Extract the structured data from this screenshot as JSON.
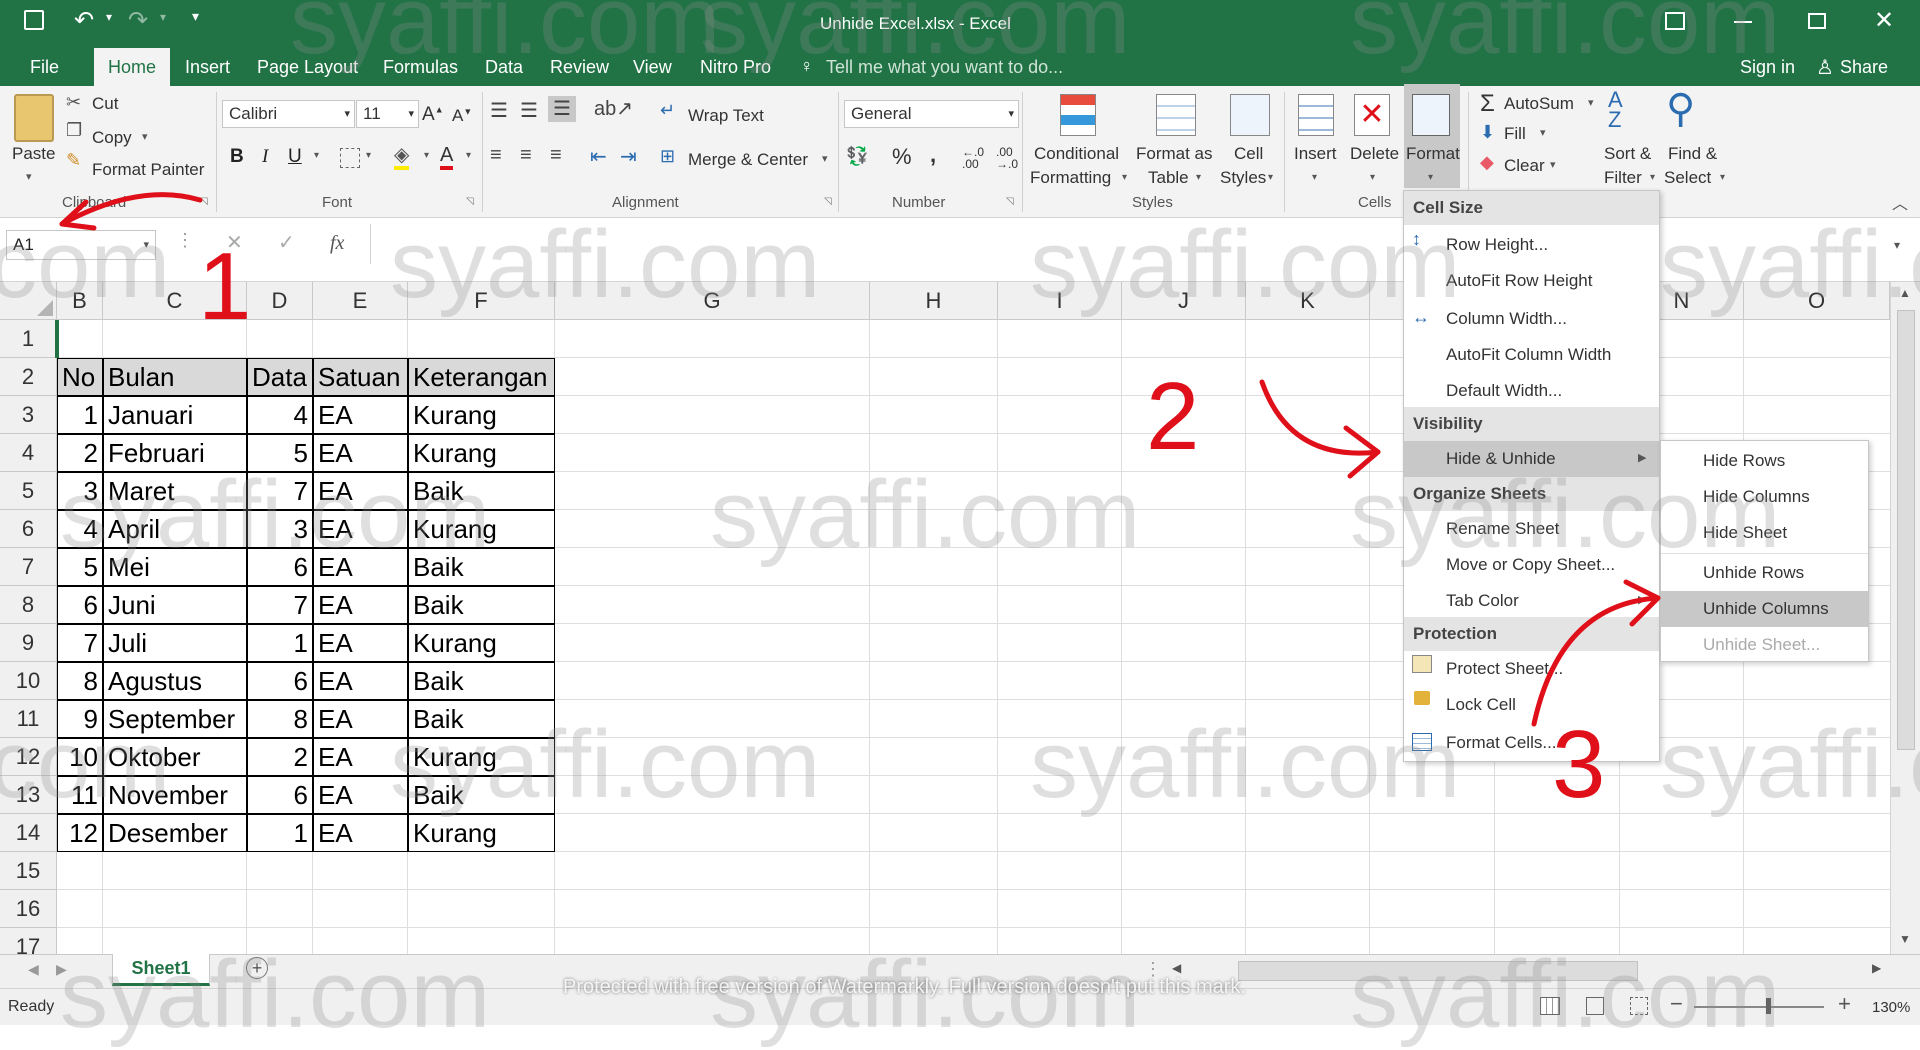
{
  "titlebar": {
    "title": "Unhide Excel.xlsx - Excel"
  },
  "tabs": {
    "file": "File",
    "home": "Home",
    "insert": "Insert",
    "page_layout": "Page Layout",
    "formulas": "Formulas",
    "data": "Data",
    "review": "Review",
    "view": "View",
    "nitro": "Nitro Pro",
    "tell_me": "Tell me what you want to do...",
    "sign_in": "Sign in",
    "share": "Share"
  },
  "ribbon": {
    "clipboard": {
      "paste": "Paste",
      "cut": "Cut",
      "copy": "Copy",
      "format_painter": "Format Painter",
      "label": "Clipboard"
    },
    "font": {
      "name": "Calibri",
      "size": "11",
      "label": "Font"
    },
    "alignment": {
      "wrap": "Wrap Text",
      "merge": "Merge & Center",
      "label": "Alignment"
    },
    "number": {
      "format": "General",
      "label": "Number"
    },
    "styles": {
      "conditional": "Conditional",
      "conditional2": "Formatting",
      "format_as": "Format as",
      "format_as2": "Table",
      "cell": "Cell",
      "cell2": "Styles",
      "label": "Styles"
    },
    "cells": {
      "insert": "Insert",
      "delete": "Delete",
      "format": "Format",
      "label": "Cells"
    },
    "editing": {
      "autosum": "AutoSum",
      "fill": "Fill",
      "clear": "Clear",
      "sort": "Sort &",
      "sort2": "Filter",
      "find": "Find &",
      "find2": "Select"
    }
  },
  "formula_bar": {
    "name_box": "A1",
    "fx": "fx"
  },
  "columns": [
    "B",
    "C",
    "D",
    "E",
    "F",
    "G",
    "H",
    "I",
    "J",
    "K",
    "N",
    "O"
  ],
  "rows": [
    "1",
    "2",
    "3",
    "4",
    "5",
    "6",
    "7",
    "8",
    "9",
    "10",
    "11",
    "12",
    "13",
    "14",
    "15",
    "16",
    "17"
  ],
  "table": {
    "headers": [
      "No",
      "Bulan",
      "Data",
      "Satuan",
      "Keterangan"
    ],
    "data": [
      [
        "1",
        "Januari",
        "4",
        "EA",
        "Kurang"
      ],
      [
        "2",
        "Februari",
        "5",
        "EA",
        "Kurang"
      ],
      [
        "3",
        "Maret",
        "7",
        "EA",
        "Baik"
      ],
      [
        "4",
        "April",
        "3",
        "EA",
        "Kurang"
      ],
      [
        "5",
        "Mei",
        "6",
        "EA",
        "Baik"
      ],
      [
        "6",
        "Juni",
        "7",
        "EA",
        "Baik"
      ],
      [
        "7",
        "Juli",
        "1",
        "EA",
        "Kurang"
      ],
      [
        "8",
        "Agustus",
        "6",
        "EA",
        "Baik"
      ],
      [
        "9",
        "September",
        "8",
        "EA",
        "Baik"
      ],
      [
        "10",
        "Oktober",
        "2",
        "EA",
        "Kurang"
      ],
      [
        "11",
        "November",
        "6",
        "EA",
        "Baik"
      ],
      [
        "12",
        "Desember",
        "1",
        "EA",
        "Kurang"
      ]
    ]
  },
  "format_menu": {
    "cell_size": "Cell Size",
    "row_height": "Row Height...",
    "autofit_row": "AutoFit Row Height",
    "column_width": "Column Width...",
    "autofit_col": "AutoFit Column Width",
    "default_width": "Default Width...",
    "visibility": "Visibility",
    "hide_unhide": "Hide & Unhide",
    "organize": "Organize Sheets",
    "rename": "Rename Sheet",
    "move_copy": "Move or Copy Sheet...",
    "tab_color": "Tab Color",
    "protection": "Protection",
    "protect_sheet": "Protect Sheet...",
    "lock_cell": "Lock Cell",
    "format_cells": "Format Cells..."
  },
  "hide_submenu": {
    "hide_rows": "Hide Rows",
    "hide_cols": "Hide Columns",
    "hide_sheet": "Hide Sheet",
    "unhide_rows": "Unhide Rows",
    "unhide_cols": "Unhide Columns",
    "unhide_sheet": "Unhide Sheet..."
  },
  "sheet_tab": "Sheet1",
  "status": {
    "ready": "Ready",
    "zoom": "130%",
    "watermarkly": "Protected with free version of Watermarkly. Full version doesn't put this mark."
  },
  "watermark_text": "syaffi.com",
  "annotations": [
    "1",
    "2",
    "3"
  ],
  "colors": {
    "excel_green": "#217346",
    "annotation_red": "#e0101a"
  }
}
